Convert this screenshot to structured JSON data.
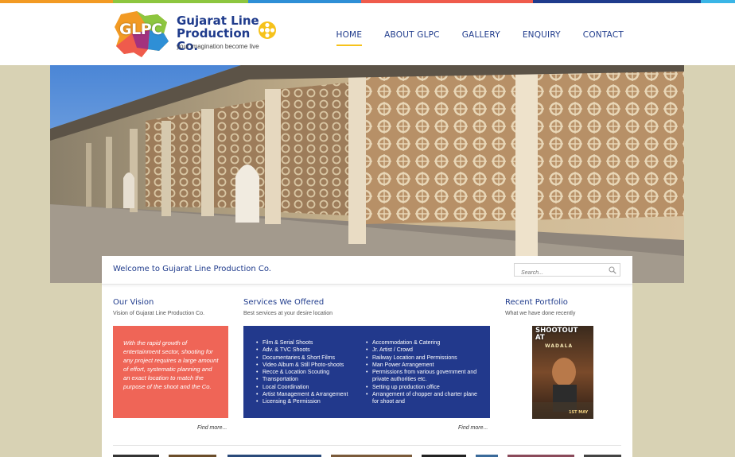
{
  "colors": {
    "stripe": [
      "#f29a24",
      "#8dc63f",
      "#2e8fd6",
      "#ef5b4c",
      "#1f3b8c",
      "#3ab5e6"
    ],
    "brand_blue": "#1f3b8c",
    "nav_underline": "#f6c21b",
    "vision_box": "#ef6557",
    "services_box": "#22398c",
    "page_bg": "#d8d2b4"
  },
  "logo": {
    "mark_text": "GLPC",
    "title": "Gujarat Line Production Co.",
    "tagline": "your imagination become live",
    "reel_icon": "film-reel-icon"
  },
  "nav": {
    "items": [
      {
        "label": "HOME",
        "active": true
      },
      {
        "label": "ABOUT GLPC",
        "active": false
      },
      {
        "label": "GALLERY",
        "active": false
      },
      {
        "label": "ENQUIRY",
        "active": false
      },
      {
        "label": "CONTACT",
        "active": false
      }
    ]
  },
  "welcome": {
    "title": "Welcome to Gujarat Line Production Co.",
    "search_placeholder": "Search...",
    "search_icon": "search-icon"
  },
  "vision": {
    "title": "Our Vision",
    "subtitle": "Vision of Gujarat Line Production Co.",
    "text": "With the rapid growth of entertainment sector, shooting for any project requires a large amount of effort, systematic planning and an exact location to match the purpose of the shoot and the Co.",
    "find_more": "Find more..."
  },
  "services": {
    "title": "Services We Offered",
    "subtitle": "Best services at your desire location",
    "left": [
      "Film & Serial Shoots",
      "Adv. & TVC Shoots",
      "Documentaries & Short Films",
      "Video Album & Still Photo-shoots",
      "Recce & Location Scouting",
      "Transportation",
      "Local Coordination",
      "Artist Management & Arrangement",
      "Licensing & Permission"
    ],
    "right": [
      "Accommodation & Catering",
      "Jr. Artist / Crowd",
      "Railway Location and Permissions",
      "Man Power Arrangement",
      "Permissions from various government and private authorities etc.",
      "Setting up production office",
      "Arrangement of chopper and charter plane for shoot and"
    ],
    "find_more": "Find more..."
  },
  "portfolio": {
    "title": "Recent Portfolio",
    "subtitle": "What we have done recently",
    "poster_title": "SHOOTOUT AT",
    "poster_title2": "WADALA",
    "poster_date": "1ST MAY"
  }
}
